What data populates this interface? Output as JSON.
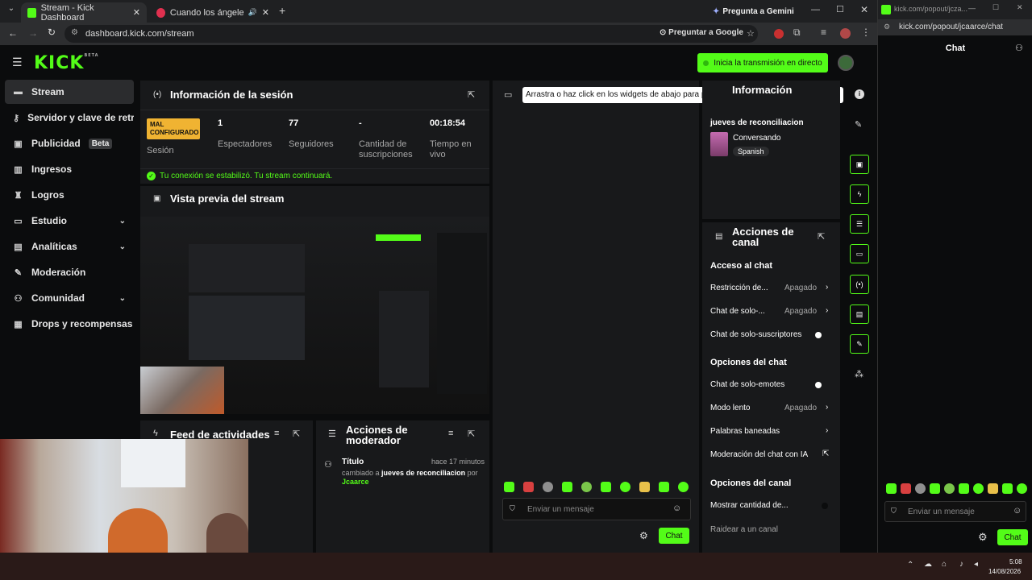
{
  "browser": {
    "tabs": [
      {
        "title": "Stream - Kick Dashboard",
        "active": true
      },
      {
        "title": "Cuando los ángeles lloran",
        "active": false
      }
    ],
    "gemini_label": "Pregunta a Gemini",
    "url": "dashboard.kick.com/stream",
    "google_label": "Preguntar a Google",
    "popout_title": "kick.com/popout/jcza...",
    "popout_url": "kick.com/popout/jcaarce/chat"
  },
  "header": {
    "logo": "KICK",
    "logo_sup": "BETA",
    "go_live_label": "Inicia la transmisión en directo"
  },
  "sidebar": {
    "items": [
      {
        "label": "Stream",
        "icon": "stream-icon",
        "active": true
      },
      {
        "label": "Servidor y clave de retransmisión",
        "icon": "key-icon"
      },
      {
        "label": "Publicidad",
        "icon": "ad-icon",
        "badge": "Beta"
      },
      {
        "label": "Ingresos",
        "icon": "chart-icon"
      },
      {
        "label": "Logros",
        "icon": "trophy-icon"
      },
      {
        "label": "Estudio",
        "icon": "studio-icon",
        "expandable": true
      },
      {
        "label": "Analíticas",
        "icon": "analytics-icon",
        "expandable": true
      },
      {
        "label": "Moderación",
        "icon": "wrench-icon"
      },
      {
        "label": "Comunidad",
        "icon": "community-icon",
        "expandable": true
      },
      {
        "label": "Drops y recompensas",
        "icon": "gift-icon"
      }
    ]
  },
  "session": {
    "title": "Información de la sesión",
    "status_badge": "MAL CONFIGURADO",
    "status_label": "Sesión",
    "stats": [
      {
        "value": "1",
        "label": "Espectadores"
      },
      {
        "value": "77",
        "label": "Seguidores"
      },
      {
        "value": "-",
        "label": "Cantidad de suscripciones"
      },
      {
        "value": "00:18:54",
        "label": "Tiempo en vivo"
      }
    ],
    "connection_msg": "Tu conexión se estabilizó. Tu stream continuará."
  },
  "preview": {
    "title": "Vista previa del stream"
  },
  "feed": {
    "title": "Feed de actividades"
  },
  "modactions": {
    "title": "Acciones de moderador",
    "entry_title": "Título",
    "entry_time": "hace 17 minutos",
    "entry_text_1": "cambiado a",
    "entry_value": "jueves de reconciliacion",
    "entry_text_2": "por",
    "entry_user": "Jcaarce"
  },
  "chat_panel": {
    "tooltip": "Arrastra o haz click en los widgets de abajo para personalizar tu propio panel de control",
    "input_placeholder": "Enviar un mensaje",
    "send_label": "Chat"
  },
  "stream_info": {
    "hidden_title": "Información",
    "stream_title": "jueves de reconciliacion",
    "category": "Conversando",
    "language": "Spanish"
  },
  "channel_actions": {
    "title": "Acciones de canal",
    "sections": {
      "chat_access": "Acceso al chat",
      "chat_options": "Opciones del chat",
      "channel_options": "Opciones del canal"
    },
    "rows": {
      "restriction_label": "Restricción de...",
      "restriction_value": "Apagado",
      "followers_label": "Chat de solo-...",
      "followers_value": "Apagado",
      "subs_label": "Chat de solo-suscriptores",
      "emotes_label": "Chat de solo-emotes",
      "slow_label": "Modo lento",
      "slow_value": "Apagado",
      "banned_label": "Palabras baneadas",
      "ai_label": "Moderación del chat con IA",
      "show_count_label": "Mostrar cantidad de...",
      "raid_label": "Raidear a un canal"
    },
    "toggles": {
      "subs_only": false,
      "emotes_only": false,
      "show_count": true
    }
  },
  "popout": {
    "title": "Chat",
    "input_placeholder": "Enviar un mensaje",
    "send_label": "Chat"
  },
  "taskbar": {
    "time": "5:08",
    "date": "14/08/2026"
  },
  "colors": {
    "accent": "#53fc18",
    "warn": "#f0b332",
    "panel": "#18191b",
    "bg": "#0b0c0d"
  }
}
